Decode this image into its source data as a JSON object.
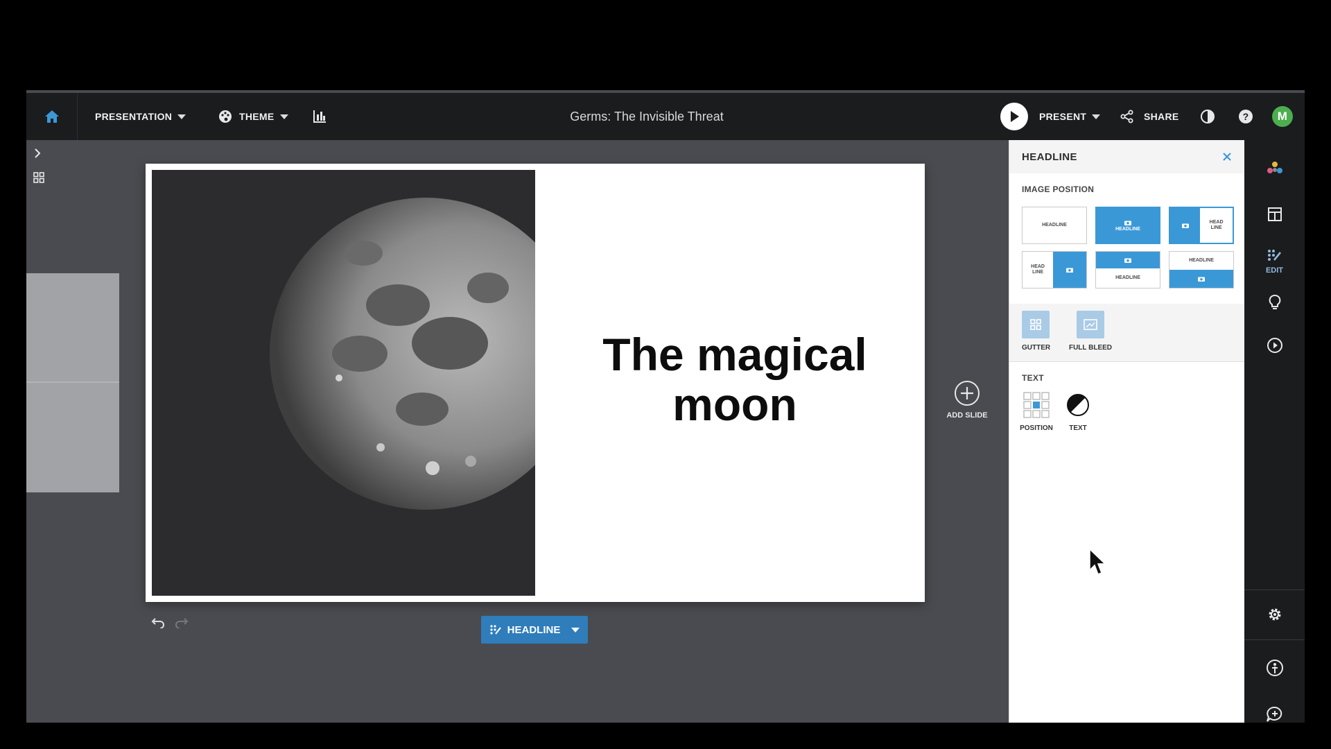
{
  "topbar": {
    "menu_presentation": "PRESENTATION",
    "menu_theme": "THEME",
    "doc_title": "Germs: The Invisible Threat",
    "present_label": "PRESENT",
    "share_label": "SHARE",
    "avatar_initial": "M"
  },
  "slide": {
    "headline": "The magical moon",
    "image_icon": "moon-photo"
  },
  "canvas": {
    "add_slide_label": "ADD SLIDE",
    "layout_button_label": "HEADLINE"
  },
  "panel": {
    "title": "HEADLINE",
    "image_position_title": "IMAGE POSITION",
    "layouts": [
      {
        "label": "HEADLINE"
      },
      {
        "label": "HEADLINE"
      },
      {
        "label": "HEAD LINE"
      },
      {
        "label": "HEAD LINE"
      },
      {
        "label": "HEADLINE"
      },
      {
        "label": "HEADLINE"
      }
    ],
    "gutter_label": "GUTTER",
    "full_bleed_label": "FULL BLEED",
    "text_title": "TEXT",
    "position_label": "POSITION",
    "text_color_label": "TEXT"
  },
  "right_rail": {
    "edit_label": "EDIT"
  },
  "colors": {
    "accent": "#3b98d7",
    "topbar": "#1b1c1e",
    "canvas": "#4a4b50",
    "avatar": "#4cae4f"
  }
}
